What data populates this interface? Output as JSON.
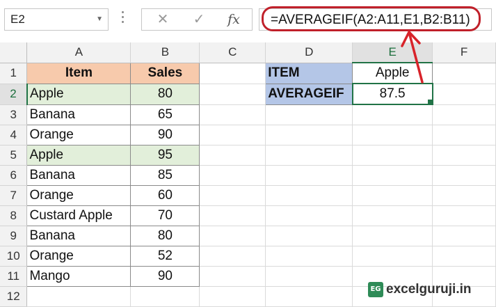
{
  "formula_bar": {
    "name_box": "E2",
    "cancel_icon": "close-icon",
    "enter_icon": "check-icon",
    "fx_label": "fx",
    "formula": "=AVERAGEIF(A2:A11,E1,B2:B11)"
  },
  "columns": [
    "A",
    "B",
    "C",
    "D",
    "E",
    "F"
  ],
  "selected_column": "E",
  "selected_row": "2",
  "rows": [
    {
      "num": "1",
      "a": "Item",
      "b": "Sales",
      "d": "ITEM",
      "e": "Apple"
    },
    {
      "num": "2",
      "a": "Apple",
      "b": "80",
      "d": "AVERAGEIF",
      "e": "87.5"
    },
    {
      "num": "3",
      "a": "Banana",
      "b": "65"
    },
    {
      "num": "4",
      "a": "Orange",
      "b": "90"
    },
    {
      "num": "5",
      "a": "Apple",
      "b": "95"
    },
    {
      "num": "6",
      "a": "Banana",
      "b": "85"
    },
    {
      "num": "7",
      "a": "Orange",
      "b": "60"
    },
    {
      "num": "8",
      "a": "Custard Apple",
      "b": "70"
    },
    {
      "num": "9",
      "a": "Banana",
      "b": "80"
    },
    {
      "num": "10",
      "a": "Orange",
      "b": "52"
    },
    {
      "num": "11",
      "a": "Mango",
      "b": "90"
    },
    {
      "num": "12"
    }
  ],
  "colors": {
    "header_fill": "#f7caac",
    "highlight_fill": "#e2efda",
    "label_fill": "#b4c6e7",
    "annotation": "#c0202a",
    "selection": "#217346"
  },
  "watermark": {
    "logo_text": "EG",
    "text": "excelguruji.in"
  }
}
